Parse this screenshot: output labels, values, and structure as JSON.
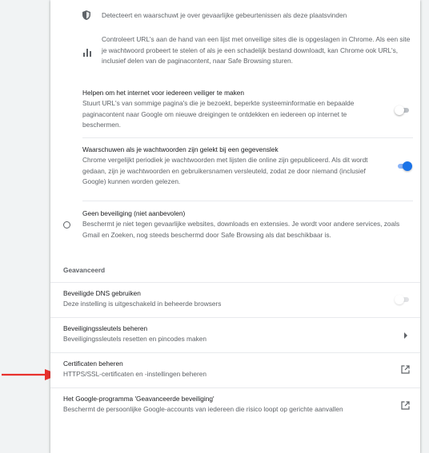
{
  "enhanced_bullets": [
    "Detecteert en waarschuwt je over gevaarlijke gebeurtenissen als deze plaatsvinden",
    "Controleert URL's aan de hand van een lijst met onveilige sites die is opgeslagen in Chrome. Als een site je wachtwoord probeert te stelen of als je een schadelijk bestand downloadt, kan Chrome ook URL's, inclusief delen van de paginacontent, naar Safe Browsing sturen."
  ],
  "help_improve": {
    "title": "Helpen om het internet voor iedereen veiliger te maken",
    "description": "Stuurt URL's van sommige pagina's die je bezoekt, beperkte systeeminformatie en bepaalde paginacontent naar Google om nieuwe dreigingen te ontdekken en iedereen op internet te beschermen.",
    "enabled": false
  },
  "password_leak": {
    "title": "Waarschuwen als je wachtwoorden zijn gelekt bij een gegevenslek",
    "description": "Chrome vergelijkt periodiek je wachtwoorden met lijsten die online zijn gepubliceerd. Als dit wordt gedaan, zijn je wachtwoorden en gebruikersnamen versleuteld, zodat ze door niemand (inclusief Google) kunnen worden gelezen.",
    "enabled": true
  },
  "no_protection": {
    "title": "Geen beveiliging (niet aanbevolen)",
    "description": "Beschermt je niet tegen gevaarlijke websites, downloads en extensies. Je wordt voor andere services, zoals Gmail en Zoeken, nog steeds beschermd door Safe Browsing als dat beschikbaar is."
  },
  "advanced": {
    "heading": "Geavanceerd",
    "items": [
      {
        "title": "Beveiligde DNS gebruiken",
        "subtitle": "Deze instelling is uitgeschakeld in beheerde browsers",
        "control": "toggle-disabled"
      },
      {
        "title": "Beveiligingssleutels beheren",
        "subtitle": "Beveiligingssleutels resetten en pincodes maken",
        "control": "arrow"
      },
      {
        "title": "Certificaten beheren",
        "subtitle": "HTTPS/SSL-certificaten en -instellingen beheren",
        "control": "external-link"
      },
      {
        "title": "Het Google-programma 'Geavanceerde beveiliging'",
        "subtitle": "Beschermt de persoonlijke Google-accounts van iedereen die risico loopt op gerichte aanvallen",
        "control": "external-link"
      }
    ]
  },
  "colors": {
    "accent": "#1a73e8",
    "annotation_arrow": "#e8312c",
    "card_background": "#ffffff",
    "page_background": "#f1f3f4"
  },
  "icons": {
    "bullet_1": "shield-icon",
    "bullet_2": "bar-chart-icon",
    "arrow": "arrow-right-icon",
    "external": "open-in-new-icon",
    "annotation": "red-arrow-annotation"
  }
}
